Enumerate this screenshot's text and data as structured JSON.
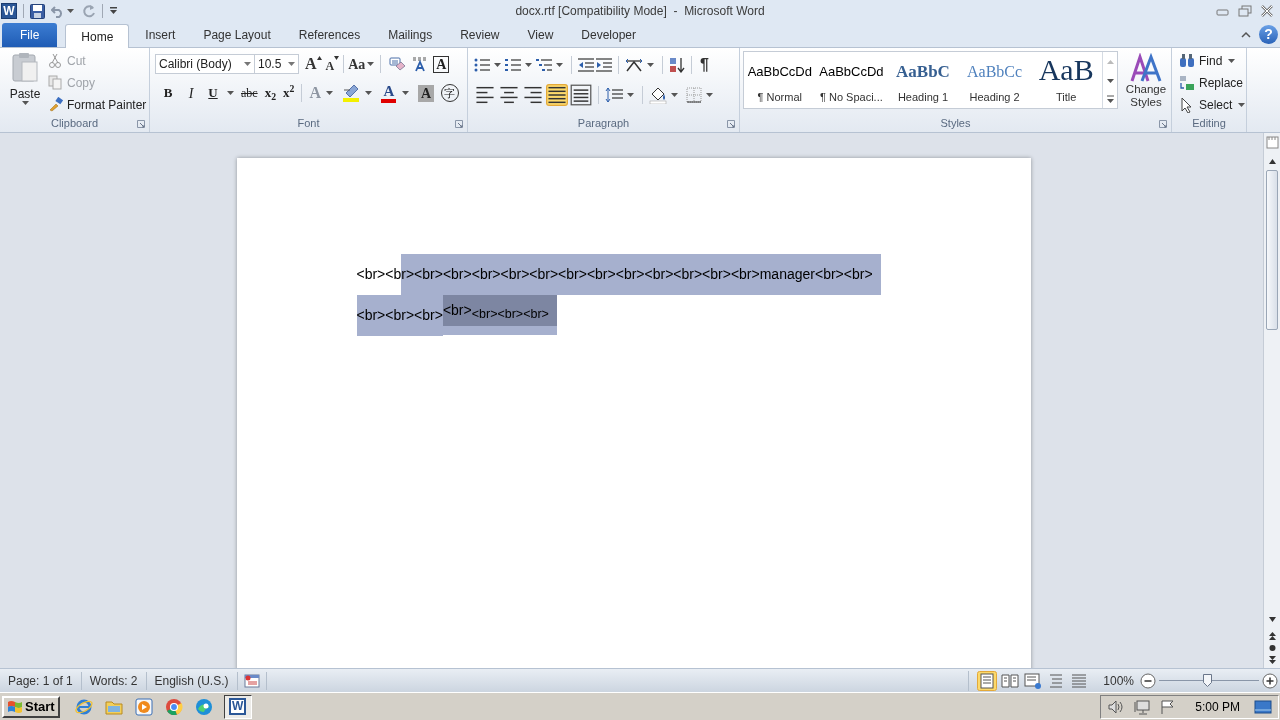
{
  "window": {
    "app_logo": "W",
    "title": "docx.rtf [Compatibility Mode]  -  Microsoft Word",
    "help": "?"
  },
  "tabs": [
    {
      "label": "File",
      "kind": "file",
      "selected": false
    },
    {
      "label": "Home",
      "kind": "tab",
      "selected": true
    },
    {
      "label": "Insert",
      "kind": "tab",
      "selected": false
    },
    {
      "label": "Page Layout",
      "kind": "tab",
      "selected": false
    },
    {
      "label": "References",
      "kind": "tab",
      "selected": false
    },
    {
      "label": "Mailings",
      "kind": "tab",
      "selected": false
    },
    {
      "label": "Review",
      "kind": "tab",
      "selected": false
    },
    {
      "label": "View",
      "kind": "tab",
      "selected": false
    },
    {
      "label": "Developer",
      "kind": "tab",
      "selected": false
    }
  ],
  "group_labels": [
    "Clipboard",
    "Font",
    "Paragraph",
    "Styles",
    "Editing"
  ],
  "clipboard": {
    "paste": "Paste",
    "items": [
      {
        "label": "Cut",
        "kind": "cut",
        "disabled": true
      },
      {
        "label": "Copy",
        "kind": "copy",
        "disabled": true
      },
      {
        "label": "Format Painter",
        "kind": "painter",
        "disabled": false
      }
    ]
  },
  "font": {
    "name": "Calibri (Body)",
    "size": "10.5",
    "tools_top": [
      {
        "label": "A",
        "kind": "grow"
      },
      {
        "label": "A",
        "kind": "shrink"
      },
      {
        "label": "Aa",
        "kind": "case"
      },
      {
        "kind": "clear"
      },
      {
        "kind": "phonetic"
      },
      {
        "label": "A",
        "kind": "border"
      }
    ],
    "tools_bottom": [
      {
        "label": "B",
        "kind": "bold"
      },
      {
        "label": "I",
        "kind": "italic"
      },
      {
        "label": "U",
        "kind": "underline"
      },
      {
        "label": "abc",
        "kind": "strike"
      },
      {
        "label": "x$_{2}$",
        "kind": "sub"
      },
      {
        "label": "x$^{2}$",
        "kind": "sup"
      },
      {
        "label": "A",
        "kind": "effects"
      },
      {
        "kind": "highlight"
      },
      {
        "label": "A",
        "kind": "color"
      },
      {
        "label": "A",
        "kind": "shading"
      },
      {
        "label": "字",
        "kind": "enclose"
      }
    ]
  },
  "paragraph": {
    "show_marks": "¶",
    "align": [
      {
        "kind": "left",
        "selected": false
      },
      {
        "kind": "center",
        "selected": false
      },
      {
        "kind": "right",
        "selected": false
      },
      {
        "kind": "justify",
        "selected": true
      },
      {
        "kind": "distributed",
        "selected": false
      }
    ]
  },
  "styles": {
    "gallery": [
      {
        "preview": "AaBbCcDd",
        "label": "¶ Normal",
        "kind": "normal"
      },
      {
        "preview": "AaBbCcDd",
        "label": "¶ No Spaci...",
        "kind": "normal"
      },
      {
        "preview": "AaBbC",
        "label": "Heading 1",
        "kind": "heading1"
      },
      {
        "preview": "AaBbCc",
        "label": "Heading 2",
        "kind": "heading2"
      },
      {
        "preview": "AaB",
        "label": "Title",
        "kind": "title"
      }
    ],
    "change_styles": "Change Styles"
  },
  "editing": [
    {
      "label": "Find",
      "kind": "find"
    },
    {
      "label": "Replace",
      "kind": "replace"
    },
    {
      "label": "Select",
      "kind": "select"
    }
  ],
  "document": {
    "lines": [
      {
        "runs": [
          {
            "text": "<br><b",
            "selected": false,
            "dark": false,
            "lowered": false
          },
          {
            "text": "r><br><br><br><br><br><br><br><br><br><br><br><br>manager<br><br>",
            "selected": true,
            "dark": false,
            "lowered": false
          }
        ]
      },
      {
        "runs": [
          {
            "text": "<br><br><br>",
            "selected": true,
            "dark": false,
            "lowered": false
          },
          {
            "text": "<br>",
            "selected": true,
            "dark": true,
            "lowered": false
          },
          {
            "text": "<br><br><br>",
            "selected": true,
            "dark": true,
            "lowered": true
          }
        ]
      }
    ]
  },
  "status_bar": {
    "page": "Page: 1 of 1",
    "words": "Words: 2",
    "language": "English (U.S.)",
    "views": [
      {
        "kind": "print",
        "selected": true
      },
      {
        "kind": "reading",
        "selected": false
      },
      {
        "kind": "web",
        "selected": false
      },
      {
        "kind": "outline",
        "selected": false
      },
      {
        "kind": "draft",
        "selected": false
      }
    ],
    "zoom": {
      "reading": "100%",
      "level": 0.48
    }
  },
  "taskbar": {
    "start": "Start",
    "apps": [
      {
        "kind": "ie",
        "selected": false
      },
      {
        "kind": "explorer",
        "selected": false
      },
      {
        "kind": "media",
        "selected": false
      },
      {
        "kind": "chrome",
        "selected": false
      },
      {
        "kind": "edge",
        "selected": false
      },
      {
        "kind": "word",
        "label": "W",
        "selected": true
      }
    ],
    "time": "5:00 PM"
  }
}
